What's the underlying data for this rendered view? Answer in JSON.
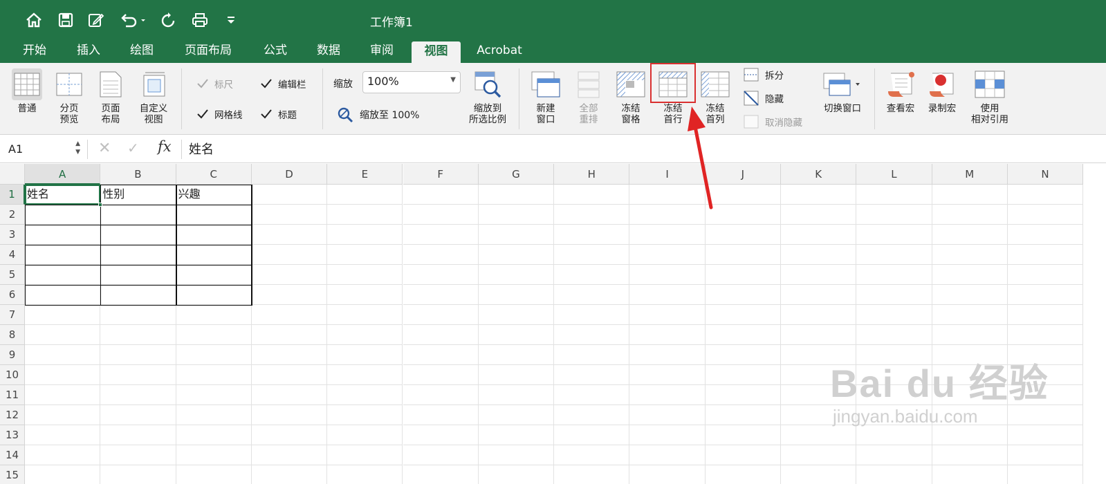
{
  "window": {
    "title": "工作簿1"
  },
  "quick_access": {
    "icons": [
      "home-icon",
      "save-icon",
      "edit-icon",
      "undo-icon",
      "redo-icon",
      "print-icon",
      "customize-icon"
    ]
  },
  "tabs": [
    {
      "label": "开始"
    },
    {
      "label": "插入"
    },
    {
      "label": "绘图"
    },
    {
      "label": "页面布局"
    },
    {
      "label": "公式"
    },
    {
      "label": "数据"
    },
    {
      "label": "审阅"
    },
    {
      "label": "视图",
      "active": true
    },
    {
      "label": "Acrobat"
    }
  ],
  "ribbon": {
    "views": {
      "normal": "普通",
      "page_break": "分页\n预览",
      "page_layout": "页面\n布局",
      "custom_views": "自定义\n视图"
    },
    "show": {
      "ruler": {
        "label": "标尺",
        "checked": true,
        "disabled": true
      },
      "formula_bar": {
        "label": "编辑栏",
        "checked": true
      },
      "gridlines": {
        "label": "网格线",
        "checked": true
      },
      "headings": {
        "label": "标题",
        "checked": true
      }
    },
    "zoom": {
      "label": "缩放",
      "value": "100%",
      "zoom_100": "缩放至 100%",
      "zoom_selection": "缩放到\n所选比例"
    },
    "window": {
      "new_window": "新建\n窗口",
      "arrange_all": "全部\n重排",
      "freeze_panes": "冻结\n窗格",
      "freeze_top_row": "冻结\n首行",
      "freeze_first_col": "冻结\n首列",
      "split": "拆分",
      "hide": "隐藏",
      "unhide": "取消隐藏",
      "switch_windows": "切换窗口"
    },
    "macros": {
      "view_macros": "查看宏",
      "record_macro": "录制宏",
      "relative_refs": "使用\n相对引用"
    }
  },
  "formula_bar": {
    "name_box": "A1",
    "fx": "fx",
    "value": "姓名"
  },
  "sheet": {
    "columns": [
      "A",
      "B",
      "C",
      "D",
      "E",
      "F",
      "G",
      "H",
      "I",
      "J",
      "K",
      "L",
      "M",
      "N"
    ],
    "rows": [
      "1",
      "2",
      "3",
      "4",
      "5",
      "6",
      "7",
      "8",
      "9",
      "10",
      "11",
      "12",
      "13",
      "14",
      "15"
    ],
    "cells": {
      "A1": "姓名",
      "B1": "性别",
      "C1": "兴趣"
    },
    "active_cell": "A1"
  },
  "watermark": {
    "brand": "Bai du 经验",
    "url": "jingyan.baidu.com"
  },
  "colors": {
    "excel_green": "#217346",
    "highlight_red": "#d93030"
  }
}
